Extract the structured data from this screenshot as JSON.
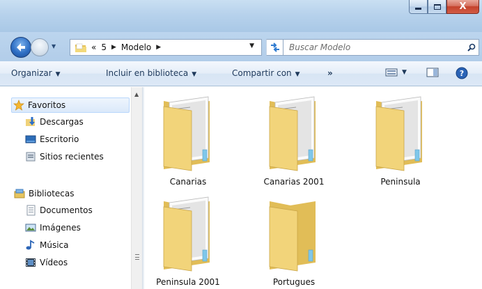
{
  "window": {
    "controls": {
      "minimize": "—",
      "maximize": "□",
      "close": "X"
    }
  },
  "address": {
    "overflow": "«",
    "crumbs": [
      "5",
      "Modelo"
    ],
    "search_placeholder": "Buscar Modelo"
  },
  "commands": {
    "organize": "Organizar",
    "include_library": "Incluir en biblioteca",
    "share_with": "Compartir con",
    "more": "»"
  },
  "nav": {
    "favorites": "Favoritos",
    "downloads": "Descargas",
    "desktop": "Escritorio",
    "recent": "Sitios recientes",
    "libraries": "Bibliotecas",
    "documents": "Documentos",
    "pictures": "Imágenes",
    "music": "Música",
    "videos": "Vídeos"
  },
  "folders": [
    {
      "name": "Canarias",
      "has_docs": true
    },
    {
      "name": "Canarias 2001",
      "has_docs": true
    },
    {
      "name": "Peninsula",
      "has_docs": true
    },
    {
      "name": "Peninsula 2001",
      "has_docs": true
    },
    {
      "name": "Portugues",
      "has_docs": false
    }
  ],
  "colors": {
    "folder": "#f1d577",
    "accent": "#1e395b",
    "selection": "#dbe9fa"
  }
}
